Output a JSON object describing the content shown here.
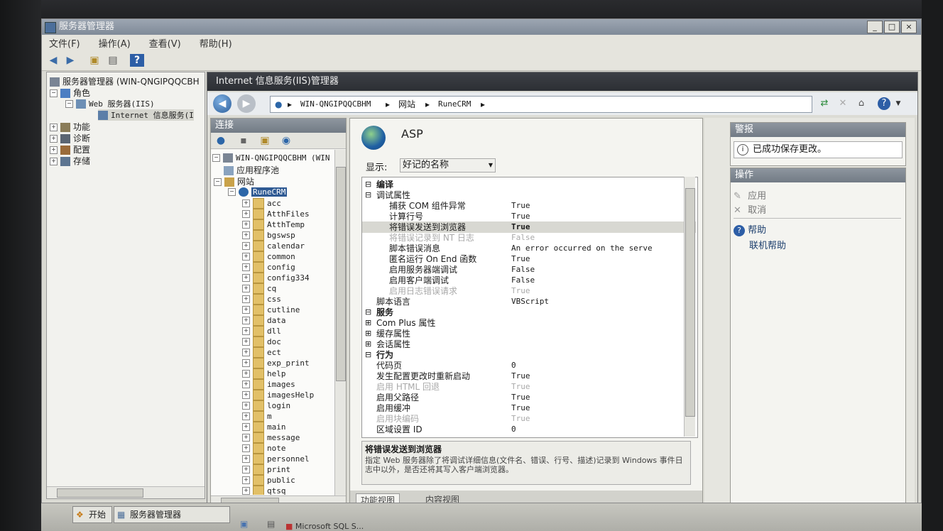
{
  "window": {
    "title": "服务器管理器",
    "min": "_",
    "max": "□",
    "close": "×"
  },
  "menu": [
    "文件(F)",
    "操作(A)",
    "查看(V)",
    "帮助(H)"
  ],
  "left_tree": {
    "root": "服务器管理器 (WIN-QNGIPQQCBH",
    "roles": "角色",
    "web": "Web 服务器(IIS)",
    "iis": "Internet 信息服务(I",
    "features": "功能",
    "diagnostics": "诊断",
    "configuration": "配置",
    "storage": "存储"
  },
  "iis": {
    "header": "Internet 信息服务(IIS)管理器",
    "breadcrumb": [
      "WIN-QNGIPQQCBHM",
      "网站",
      "RuneCRM"
    ]
  },
  "connections": {
    "title": "连接",
    "server": "WIN-QNGIPQQCBHM (WIN",
    "app_pools": "应用程序池",
    "sites": "网站",
    "site": "RuneCRM",
    "folders": [
      "acc",
      "AtthFiles",
      "AtthTemp",
      "bgswsp",
      "calendar",
      "common",
      "config",
      "config334",
      "cq",
      "css",
      "cutline",
      "data",
      "dll",
      "doc",
      "ect",
      "exp_print",
      "help",
      "images",
      "imagesHelp",
      "login",
      "m",
      "main",
      "message",
      "note",
      "personnel",
      "print",
      "public",
      "qtsq"
    ]
  },
  "asp": {
    "title": "ASP",
    "display_label": "显示:",
    "display_value": "好记的名称",
    "rows": [
      {
        "n": "编译",
        "v": "",
        "t": "grp",
        "sign": "⊟"
      },
      {
        "n": "调试属性",
        "v": "",
        "t": "sub",
        "sign": "⊟"
      },
      {
        "n": "捕获 COM 组件异常",
        "v": "True",
        "t": "item"
      },
      {
        "n": "计算行号",
        "v": "True",
        "t": "item"
      },
      {
        "n": "将错误发送到浏览器",
        "v": "True",
        "t": "item-sel"
      },
      {
        "n": "将错误记录到 NT 日志",
        "v": "False",
        "t": "item-dis"
      },
      {
        "n": "脚本错误消息",
        "v": "An error occurred on the serve",
        "t": "item"
      },
      {
        "n": "匿名运行 On End 函数",
        "v": "True",
        "t": "item"
      },
      {
        "n": "启用服务器端调试",
        "v": "False",
        "t": "item"
      },
      {
        "n": "启用客户端调试",
        "v": "False",
        "t": "item"
      },
      {
        "n": "启用日志错误请求",
        "v": "True",
        "t": "item-dis"
      },
      {
        "n": "脚本语言",
        "v": "VBScript",
        "t": "subitem"
      },
      {
        "n": "服务",
        "v": "",
        "t": "grp",
        "sign": "⊟"
      },
      {
        "n": "Com Plus 属性",
        "v": "",
        "t": "sub",
        "sign": "⊞"
      },
      {
        "n": "缓存属性",
        "v": "",
        "t": "sub",
        "sign": "⊞"
      },
      {
        "n": "会话属性",
        "v": "",
        "t": "sub",
        "sign": "⊞"
      },
      {
        "n": "行为",
        "v": "",
        "t": "grp",
        "sign": "⊟"
      },
      {
        "n": "代码页",
        "v": "0",
        "t": "subitem"
      },
      {
        "n": "发生配置更改时重新启动",
        "v": "True",
        "t": "subitem"
      },
      {
        "n": "启用 HTML 回退",
        "v": "True",
        "t": "subitem-dis"
      },
      {
        "n": "启用父路径",
        "v": "True",
        "t": "subitem"
      },
      {
        "n": "启用缓冲",
        "v": "True",
        "t": "subitem"
      },
      {
        "n": "启用块编码",
        "v": "True",
        "t": "subitem-dis"
      },
      {
        "n": "区域设置 ID",
        "v": "0",
        "t": "subitem"
      }
    ],
    "desc_title": "将错误发送到浏览器",
    "desc_text": "指定 Web 服务器除了将调试详细信息(文件名、错误、行号、描述)记录到 Windows 事件日志中以外，是否还将其写入客户端浏览器。",
    "tab_features": "功能视图",
    "tab_content": "内容视图"
  },
  "alerts": {
    "title": "警报",
    "message": "已成功保存更改。"
  },
  "actions": {
    "title": "操作",
    "apply": "应用",
    "cancel": "取消",
    "help": "帮助",
    "online_help": "联机帮助"
  },
  "taskbar": {
    "start": "开始",
    "server_manager": "服务器管理器",
    "sql": "Microsoft SQL S..."
  }
}
